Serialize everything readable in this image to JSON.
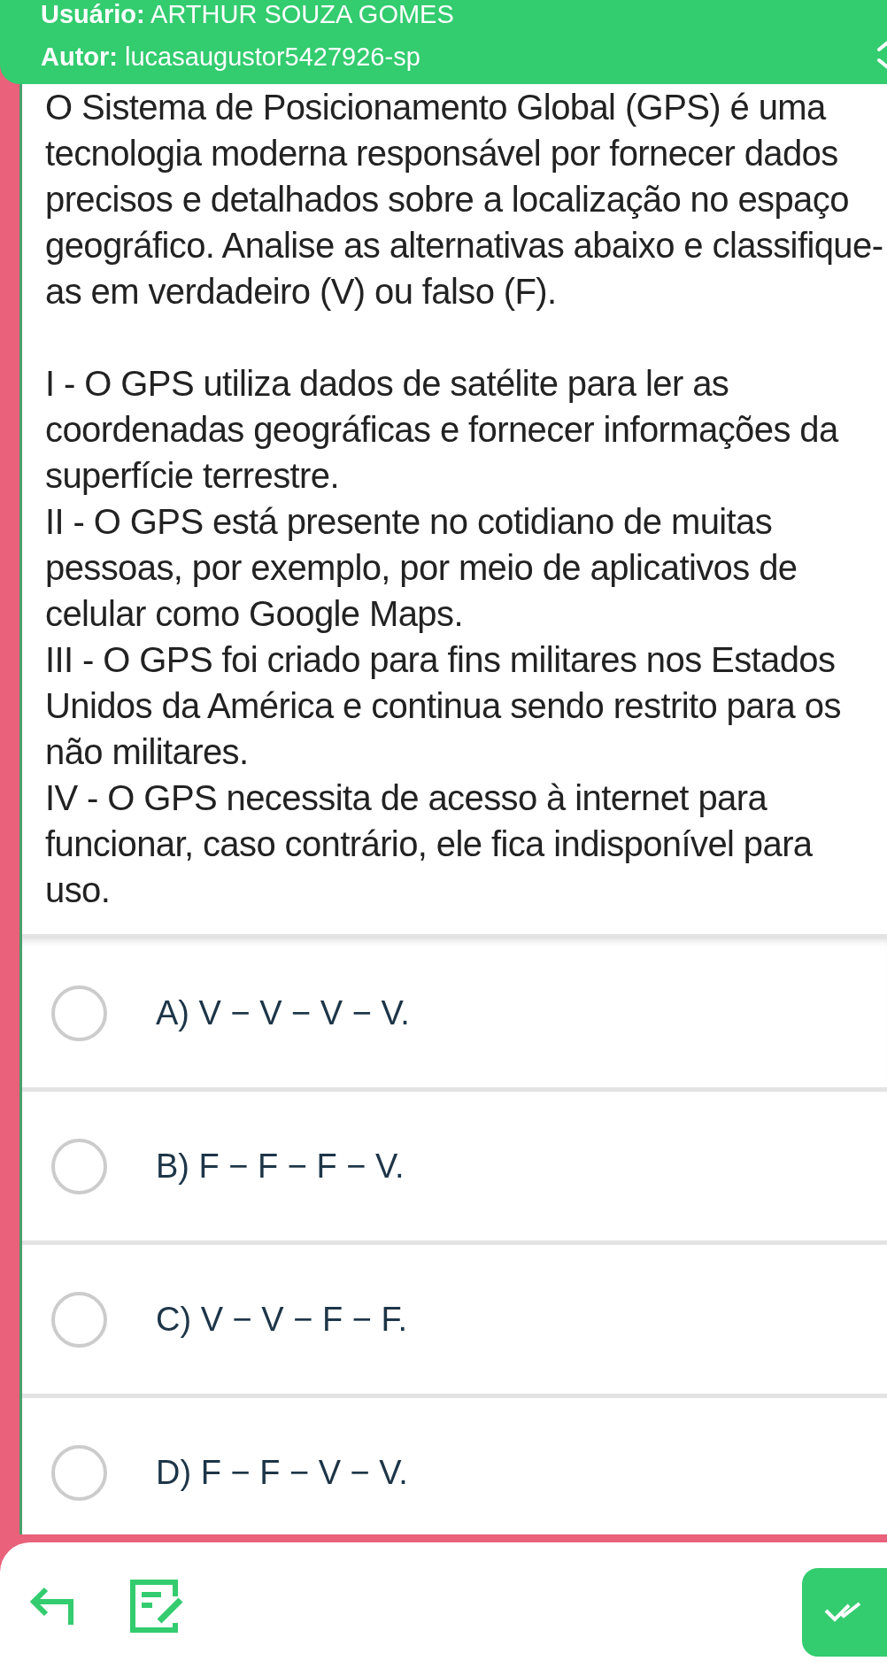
{
  "header": {
    "user_label": "Usuário:",
    "user_name": "ARTHUR SOUZA GOMES",
    "author_label": "Autor:",
    "author_name": "lucasaugustor5427926-sp"
  },
  "question": {
    "statement": "O Sistema de Posicionamento Global (GPS) é uma tecnologia moderna responsável por fornecer dados precisos e detalhados sobre a localização no espaço geográfico. Analise as alternativas abaixo e classifique-as em verdadeiro (V) ou falso (F).",
    "items": [
      "I - O GPS utiliza dados de satélite para ler as coordenadas geográficas e fornecer informações da superfície terrestre.",
      "II - O GPS está presente no cotidiano de muitas pessoas, por exemplo, por meio de aplicativos de celular como Google Maps.",
      "III - O GPS foi criado para fins militares nos Estados Unidos da América e continua sendo restrito para os não militares.",
      "IV - O GPS necessita de acesso à internet para funcionar, caso contrário, ele fica indisponível para uso."
    ]
  },
  "options": [
    {
      "text": "A) V − V − V − V.",
      "selected": false
    },
    {
      "text": "B) F − F − F − V.",
      "selected": false
    },
    {
      "text": "C) V − V − F − F.",
      "selected": false
    },
    {
      "text": "D) F − F − V − V.",
      "selected": false
    }
  ]
}
